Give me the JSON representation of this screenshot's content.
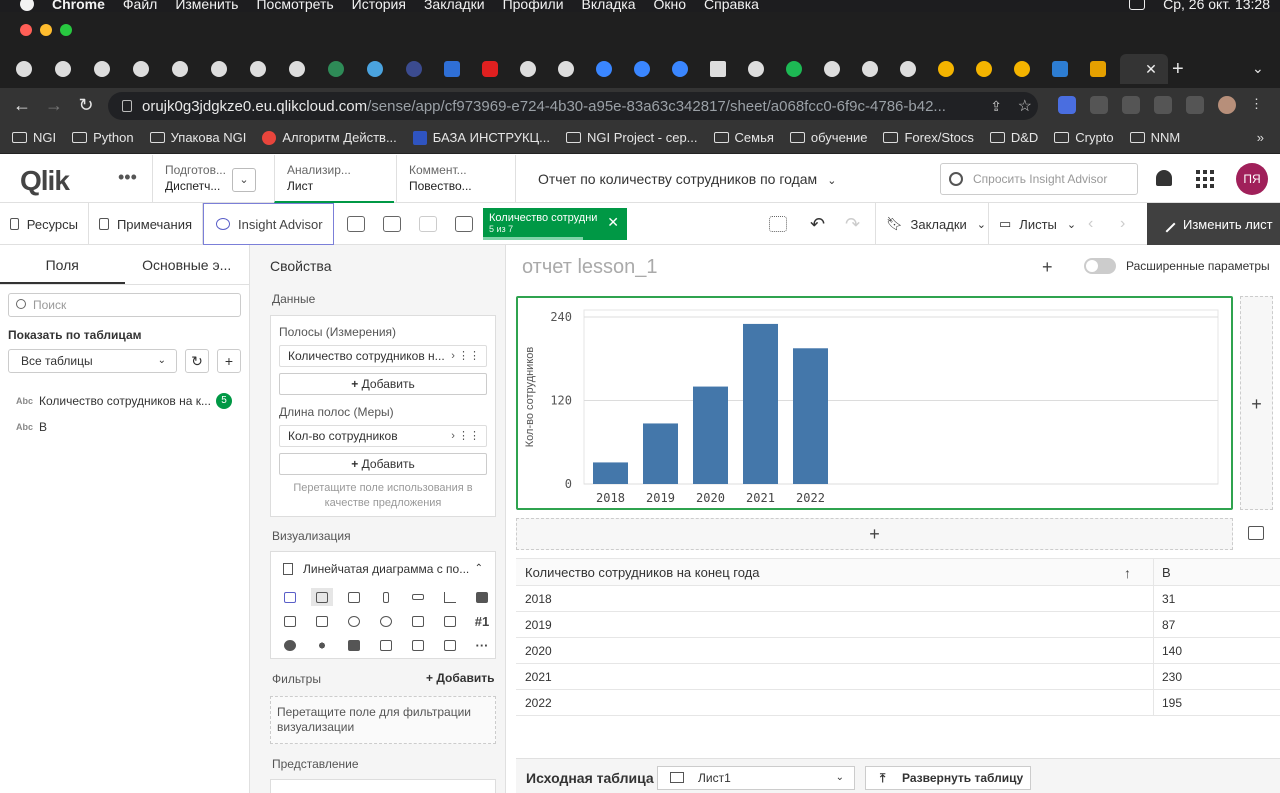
{
  "mac_menu": {
    "app": "Chrome",
    "items": [
      "Файл",
      "Изменить",
      "Посмотреть",
      "История",
      "Закладки",
      "Профили",
      "Вкладка",
      "Окно",
      "Справка"
    ],
    "clock": "Ср, 26 окт. 13:28"
  },
  "browser": {
    "url_host": "orujk0g3jdgkze0.eu.qlikcloud.com",
    "url_path": "/sense/app/cf973969-e724-4b30-a95e-83a63c342817/sheet/a068fcc0-6f9c-4786-b42...",
    "bookmarks": [
      "NGI",
      "Python",
      "Упакова NGI",
      "Алгоритм Действ...",
      "БАЗА ИНСТРУКЦ...",
      "NGI Project - сер...",
      "Семья",
      "обучение",
      "Forex/Stocs",
      "D&D",
      "Crypto",
      "NNM"
    ],
    "more": "»"
  },
  "qlik": {
    "logo_a": "Qlik",
    "logo_b": "Q",
    "dots": "•••",
    "stages": [
      {
        "top": "Подготов...",
        "bottom": "Диспетч..."
      },
      {
        "top": "Анализир...",
        "bottom": "Лист"
      },
      {
        "top": "Коммент...",
        "bottom": "Повество..."
      }
    ],
    "app_title": "Отчет по количеству сотрудников по годам",
    "ask_placeholder": "Спросить Insight Advisor",
    "user_initials": "ПЯ"
  },
  "toolbar": {
    "resources": "Ресурсы",
    "notes": "Примечания",
    "insight": "Insight Advisor",
    "selection_chip": {
      "title": "Количество сотрудников на конец года",
      "sub": "5 из 7"
    },
    "bookmarks": "Закладки",
    "sheets": "Листы",
    "edit_sheet": "Изменить лист"
  },
  "left_panel": {
    "tabs": [
      "Поля",
      "Основные э..."
    ],
    "search_placeholder": "Поиск",
    "show_by_tables": "Показать по таблицам",
    "all_tables": "Все таблицы",
    "fields": [
      {
        "type": "Abc",
        "name": "Количество сотрудников на к...",
        "count": "5"
      },
      {
        "type": "Abc",
        "name": "В",
        "count": ""
      }
    ]
  },
  "properties": {
    "title": "Свойства",
    "data": "Данные",
    "dimensions_label": "Полосы (Измерения)",
    "dimension": "Количество сотрудников н...",
    "add": "Добавить",
    "measures_label": "Длина полос (Меры)",
    "measure": "Кол-во сотрудников",
    "drop_hint": "Перетащите поле использования в качестве предложения",
    "viz_label": "Визуализация",
    "viz_selected": "Линейчатая диаграмма с по...",
    "filters_label": "Фильтры",
    "filters_add": "Добавить",
    "filters_hint": "Перетащите поле для фильтрации визуализации",
    "presentation": "Представление"
  },
  "sheet": {
    "title": "отчет lesson_1",
    "advanced": "Расширенные параметры",
    "table": {
      "headers": [
        "Количество сотрудников на конец года",
        "В"
      ],
      "rows": [
        [
          "2018",
          "31"
        ],
        [
          "2019",
          "87"
        ],
        [
          "2020",
          "140"
        ],
        [
          "2021",
          "230"
        ],
        [
          "2022",
          "195"
        ]
      ]
    },
    "source_label": "Исходная таблица",
    "source_select": "Лист1",
    "expand_table": "Развернуть таблицу"
  },
  "chart_data": {
    "type": "bar",
    "categories": [
      "2018",
      "2019",
      "2020",
      "2021",
      "2022"
    ],
    "values": [
      31,
      87,
      140,
      230,
      195
    ],
    "ylabel": "Кол-во сотрудников",
    "xlabel": "",
    "yticks": [
      0,
      120,
      240
    ],
    "ylim": [
      0,
      250
    ],
    "grid": true,
    "bar_color": "#4477aa"
  },
  "colors": {
    "qlik_green": "#009845",
    "bar": "#4477aa",
    "avatar": "#a0205a"
  }
}
